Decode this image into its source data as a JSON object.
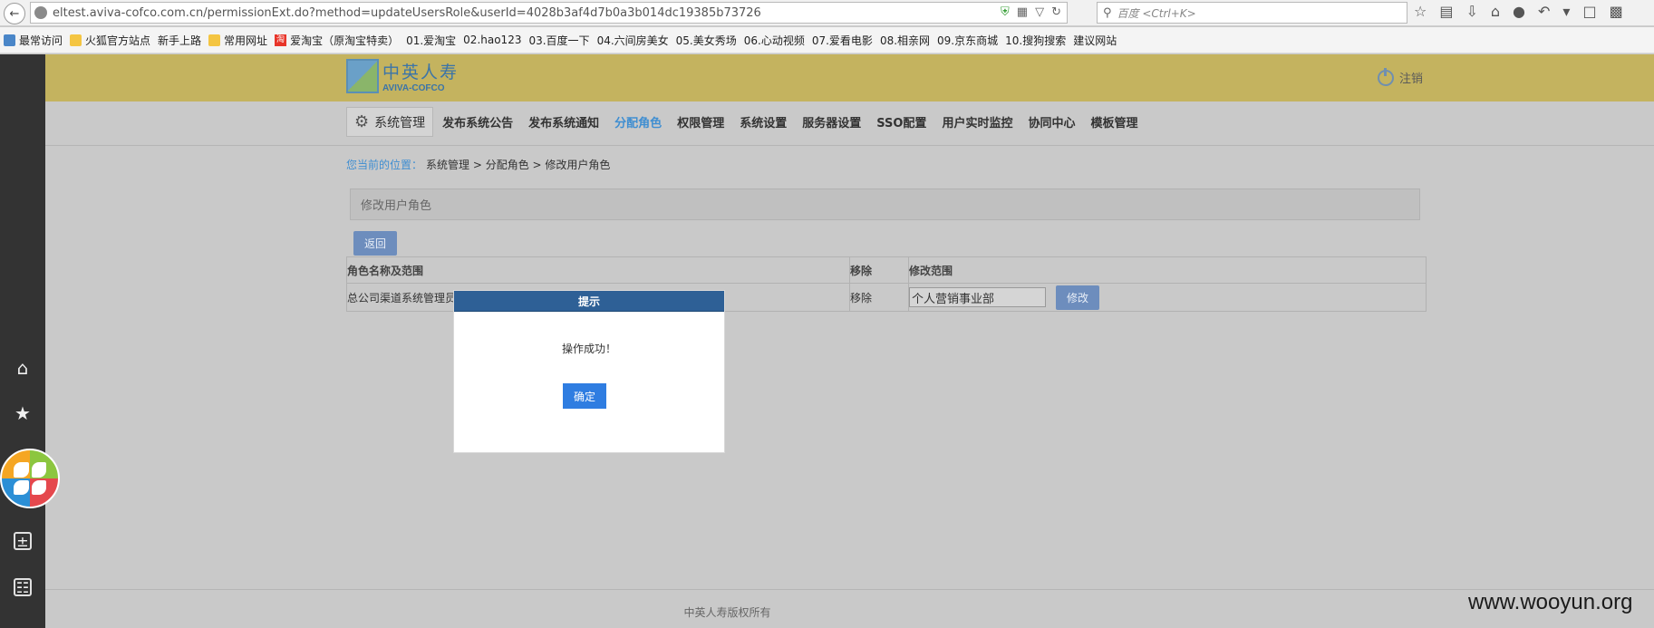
{
  "browser": {
    "url": "eltest.aviva-cofco.com.cn/permissionExt.do?method=updateUsersRole&userId=4028b3af4d7b0a3b014dc19385b73726",
    "search_placeholder": "百度 <Ctrl+K>"
  },
  "bookmarks": [
    {
      "label": "最常访问",
      "icon": "star"
    },
    {
      "label": "火狐官方站点",
      "icon": "folder"
    },
    {
      "label": "新手上路",
      "icon": "page"
    },
    {
      "label": "常用网址",
      "icon": "folder"
    },
    {
      "label": "爱淘宝（原淘宝特卖）",
      "icon": "taobao"
    },
    {
      "label": "01.爱淘宝",
      "icon": "page"
    },
    {
      "label": "02.hao123",
      "icon": "page"
    },
    {
      "label": "03.百度一下",
      "icon": "page"
    },
    {
      "label": "04.六间房美女",
      "icon": "page"
    },
    {
      "label": "05.美女秀场",
      "icon": "page"
    },
    {
      "label": "06.心动视频",
      "icon": "page"
    },
    {
      "label": "07.爱看电影",
      "icon": "page"
    },
    {
      "label": "08.相亲网",
      "icon": "page"
    },
    {
      "label": "09.京东商城",
      "icon": "page"
    },
    {
      "label": "10.搜狗搜索",
      "icon": "page"
    },
    {
      "label": "建议网站",
      "icon": "page"
    }
  ],
  "header": {
    "brand_cn": "中英人寿",
    "brand_en": "AVIVA-COFCO",
    "logout": "注销",
    "bg_color": "#c4b35f"
  },
  "menu": {
    "system": "系统管理",
    "items": [
      "发布系统公告",
      "发布系统通知",
      "分配角色",
      "权限管理",
      "系统设置",
      "服务器设置",
      "SSO配置",
      "用户实时监控",
      "协同中心",
      "模板管理"
    ],
    "active_index": 2
  },
  "breadcrumb": {
    "label": "您当前的位置：",
    "path": "系统管理 > 分配角色 > 修改用户角色"
  },
  "section_title": "修改用户角色",
  "back_button": "返回",
  "table": {
    "headers": [
      "角色名称及范围",
      "移除",
      "修改范围"
    ],
    "row": {
      "role": "总公司渠道系统管理员",
      "remove": "移除",
      "range": "个人营销事业部",
      "edit": "修改"
    }
  },
  "footer": "中英人寿版权所有",
  "modal": {
    "title": "提示",
    "message": "操作成功！",
    "ok": "确定"
  },
  "watermark": "www.wooyun.org"
}
